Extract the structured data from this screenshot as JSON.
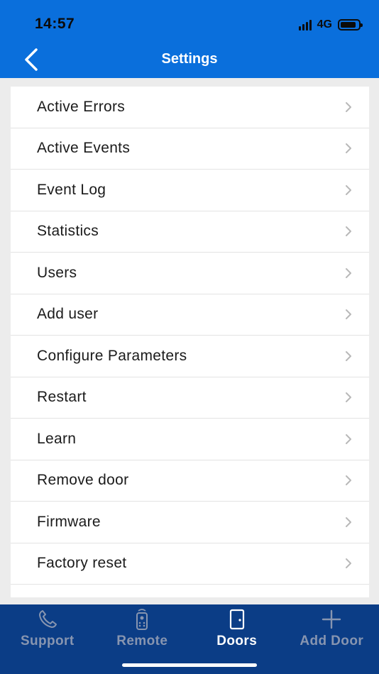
{
  "status_bar": {
    "time": "14:57",
    "network": "4G"
  },
  "header": {
    "title": "Settings",
    "background": "#0a6fdc"
  },
  "menu": {
    "items": [
      {
        "label": "Active Errors"
      },
      {
        "label": "Active Events"
      },
      {
        "label": "Event Log"
      },
      {
        "label": "Statistics"
      },
      {
        "label": "Users"
      },
      {
        "label": "Add user"
      },
      {
        "label": "Configure Parameters"
      },
      {
        "label": "Restart"
      },
      {
        "label": "Learn"
      },
      {
        "label": "Remove door"
      },
      {
        "label": "Firmware"
      },
      {
        "label": "Factory reset"
      },
      {
        "label": ""
      }
    ]
  },
  "tabbar": {
    "background": "#0b3d86",
    "tabs": [
      {
        "label": "Support",
        "icon": "phone-icon",
        "active": false
      },
      {
        "label": "Remote",
        "icon": "remote-icon",
        "active": false
      },
      {
        "label": "Doors",
        "icon": "door-icon",
        "active": true
      },
      {
        "label": "Add Door",
        "icon": "plus-icon",
        "active": false
      }
    ]
  }
}
